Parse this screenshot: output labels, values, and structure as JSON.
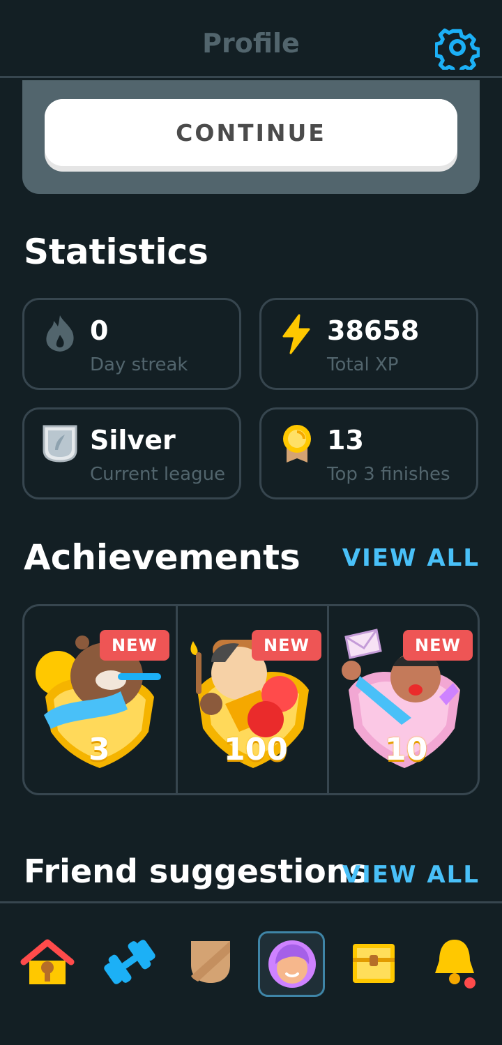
{
  "header": {
    "title": "Profile",
    "settings_icon": "gear-icon"
  },
  "promo": {
    "continue_label": "CONTINUE"
  },
  "statistics": {
    "title": "Statistics",
    "cards": [
      {
        "icon": "flame-icon",
        "value": "0",
        "label": "Day streak"
      },
      {
        "icon": "lightning-icon",
        "value": "38658",
        "label": "Total XP"
      },
      {
        "icon": "silver-league-shield-icon",
        "value": "Silver",
        "label": "Current league"
      },
      {
        "icon": "medal-icon",
        "value": "13",
        "label": "Top 3 finishes"
      }
    ]
  },
  "achievements": {
    "title": "Achievements",
    "view_all": "VIEW ALL",
    "items": [
      {
        "badge": "NEW",
        "number": "3",
        "icon": "bear-achievement-icon"
      },
      {
        "badge": "NEW",
        "number": "100",
        "icon": "boxer-achievement-icon"
      },
      {
        "badge": "NEW",
        "number": "10",
        "icon": "envelope-achievement-icon"
      }
    ]
  },
  "friends": {
    "title": "Friend suggestions",
    "view_all": "VIEW ALL"
  },
  "tabbar": {
    "items": [
      {
        "name": "home",
        "icon": "house-icon",
        "active": false
      },
      {
        "name": "practice",
        "icon": "dumbbell-icon",
        "active": false
      },
      {
        "name": "leagues",
        "icon": "shield-icon",
        "active": false
      },
      {
        "name": "profile",
        "icon": "avatar-icon",
        "active": true
      },
      {
        "name": "shop",
        "icon": "treasure-chest-icon",
        "active": false
      },
      {
        "name": "notifications",
        "icon": "bell-icon",
        "active": false
      }
    ]
  },
  "colors": {
    "background": "#131f24",
    "border": "#37464f",
    "accent_blue": "#49c0f8",
    "new_badge": "#ee5555",
    "muted_text": "#52656d"
  }
}
